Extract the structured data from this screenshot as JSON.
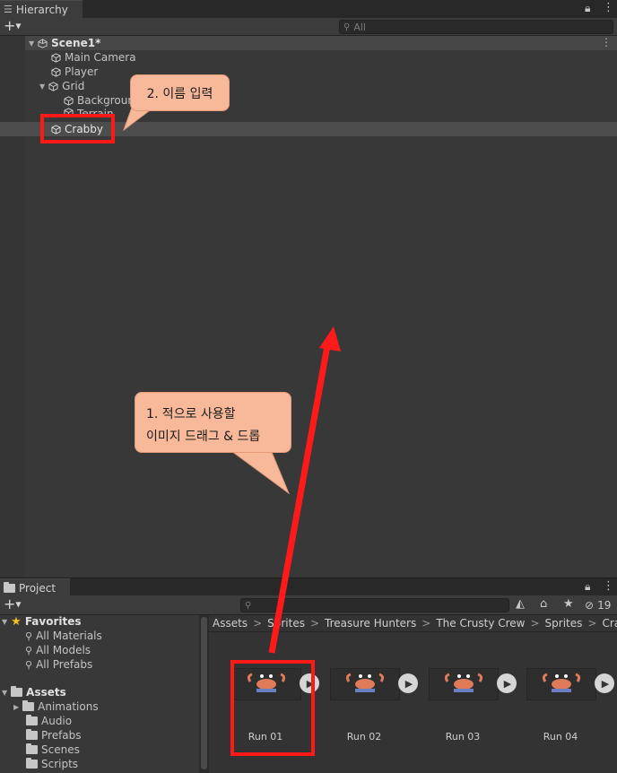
{
  "hierarchy": {
    "tab_label": "Hierarchy",
    "search_placeholder": "All",
    "add_label": "+",
    "scene_name": "Scene1*",
    "items": [
      {
        "label": "Main Camera"
      },
      {
        "label": "Player"
      },
      {
        "label": "Grid"
      },
      {
        "label": "Background"
      },
      {
        "label": "Terrain"
      },
      {
        "label": "Crabby"
      }
    ]
  },
  "annotations": {
    "callout_rename": "2. 이름 입력",
    "callout_drag_line1": "1. 적으로 사용할",
    "callout_drag_line2": "이미지 드래그 & 드롭",
    "highlight_color": "#ff1a1a",
    "callout_color": "#f7b99a"
  },
  "project": {
    "tab_label": "Project",
    "add_label": "+",
    "hidden_count": "19",
    "favorites_label": "Favorites",
    "favorites": [
      "All Materials",
      "All Models",
      "All Prefabs"
    ],
    "assets_label": "Assets",
    "asset_folders": [
      "Animations",
      "Audio",
      "Prefabs",
      "Scenes",
      "Scripts"
    ],
    "breadcrumb": [
      "Assets",
      "Sprites",
      "Treasure Hunters",
      "The Crusty Crew",
      "Sprites",
      "Crabby"
    ],
    "sprites": [
      {
        "label": "Run 01"
      },
      {
        "label": "Run 02"
      },
      {
        "label": "Run 03"
      },
      {
        "label": "Run 04"
      }
    ]
  }
}
